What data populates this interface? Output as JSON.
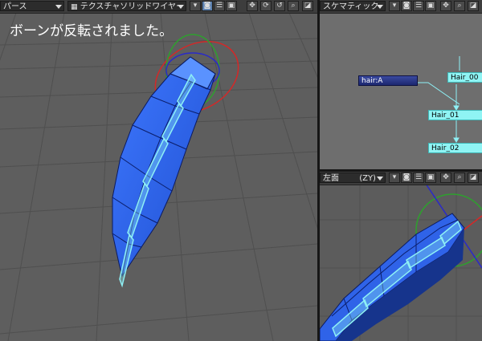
{
  "perspective": {
    "view_label": "パース",
    "render_mode": "テクスチャソリッドワイヤー",
    "caption": "ボーンが反転されました。"
  },
  "schematic": {
    "view_label": "スケマティック",
    "nodes": [
      {
        "label": "hair:A",
        "style": "navy"
      },
      {
        "label": "Hair_00",
        "style": "cyan"
      },
      {
        "label": "Hair_01",
        "style": "cyan"
      },
      {
        "label": "Hair_02",
        "style": "cyan"
      }
    ]
  },
  "left_view": {
    "view_label": "左面",
    "axis_label": "(ZY)"
  },
  "icons": [
    "toggle-icon",
    "camera-icon",
    "list-icon",
    "save-icon",
    "move-icon",
    "rotate-icon",
    "reset-icon",
    "zoom-icon",
    "maximize-icon"
  ],
  "colors": {
    "mesh_blue": "#2f63e8",
    "bone_cyan": "#8ef0f5",
    "gizmo_red": "#d42828",
    "gizmo_green": "#2ea02e",
    "gizmo_blue": "#2a2ac8",
    "viewport_bg": "#5c5c5c",
    "schematic_bg": "#6e6e6e",
    "node_cyan": "#8ff4f4",
    "node_navy": "#26328a"
  }
}
